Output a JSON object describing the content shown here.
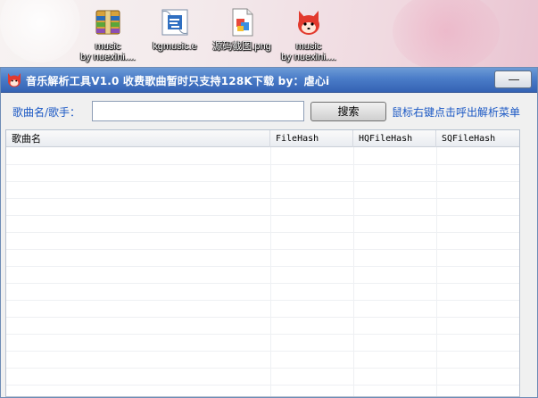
{
  "desktop": {
    "icons": [
      {
        "line1": "music",
        "line2": "by  nuexini....",
        "icon": "winrar-archive-icon"
      },
      {
        "line1": "kgmusic.e",
        "line2": "",
        "icon": "exe-file-icon"
      },
      {
        "line1": "源码截图.png",
        "line2": "",
        "icon": "png-image-icon"
      },
      {
        "line1": "music",
        "line2": "by  nuexini....",
        "icon": "ali-fox-exe-icon"
      }
    ]
  },
  "window": {
    "title": "音乐解析工具V1.0  收费歌曲暂时只支持128K下载       by：虐心i",
    "app_icon": "ali-fox-icon"
  },
  "toolbar": {
    "label": "歌曲名/歌手：",
    "search_value": "",
    "search_button": "搜索",
    "hint": "鼠标右键点击呼出解析菜单"
  },
  "table": {
    "columns": [
      "歌曲名",
      "FileHash",
      "HQFileHash",
      "SQFileHash"
    ],
    "rows": []
  },
  "colors": {
    "title_bar": "#4a7cc8",
    "label_blue": "#1b58c4"
  }
}
